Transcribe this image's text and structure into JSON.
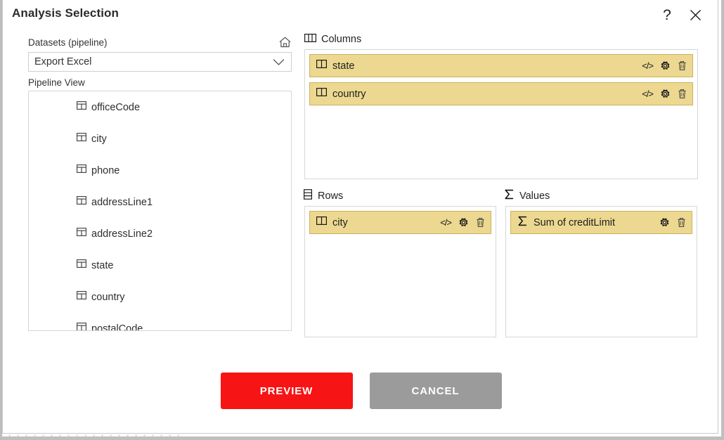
{
  "dialog": {
    "title": "Analysis Selection",
    "help_icon": "question-mark-icon",
    "help_label": "?",
    "close_icon": "close-icon"
  },
  "left": {
    "datasets_label": "Datasets (pipeline)",
    "home_icon": "home-icon",
    "dataset_select": {
      "value": "Export Excel",
      "caret_icon": "chevron-down-icon"
    },
    "pipeline_view_label": "Pipeline View",
    "pipeline_items": [
      {
        "label": "officeCode",
        "icon": "table-field-icon"
      },
      {
        "label": "city",
        "icon": "table-field-icon"
      },
      {
        "label": "phone",
        "icon": "table-field-icon"
      },
      {
        "label": "addressLine1",
        "icon": "table-field-icon"
      },
      {
        "label": "addressLine2",
        "icon": "table-field-icon"
      },
      {
        "label": "state",
        "icon": "table-field-icon"
      },
      {
        "label": "country",
        "icon": "table-field-icon"
      },
      {
        "label": "postalCode",
        "icon": "table-field-icon"
      }
    ]
  },
  "panels": {
    "columns": {
      "title": "Columns",
      "icon": "columns-icon",
      "chips": [
        {
          "label": "state",
          "icon": "dimension-icon",
          "code_label": "</>",
          "has_code": true,
          "has_gear": true,
          "has_delete": true
        },
        {
          "label": "country",
          "icon": "dimension-icon",
          "code_label": "</>",
          "has_code": true,
          "has_gear": true,
          "has_delete": true
        }
      ]
    },
    "rows": {
      "title": "Rows",
      "icon": "rows-icon",
      "chips": [
        {
          "label": "city",
          "icon": "dimension-icon",
          "code_label": "</>",
          "has_code": true,
          "has_gear": true,
          "has_delete": true
        }
      ]
    },
    "values": {
      "title": "Values",
      "icon": "sigma-icon",
      "chips": [
        {
          "label": "Sum of creditLimit",
          "icon": "sigma-icon",
          "code_label": "",
          "has_code": false,
          "has_gear": true,
          "has_delete": true
        }
      ]
    }
  },
  "footer": {
    "preview_label": "PREVIEW",
    "cancel_label": "CANCEL"
  },
  "colors": {
    "preview_button": "#f71414",
    "cancel_button": "#9b9b9b",
    "chip_fill": "#ecd890",
    "chip_border": "#cdb25f",
    "dots": "#9aa8e0"
  }
}
